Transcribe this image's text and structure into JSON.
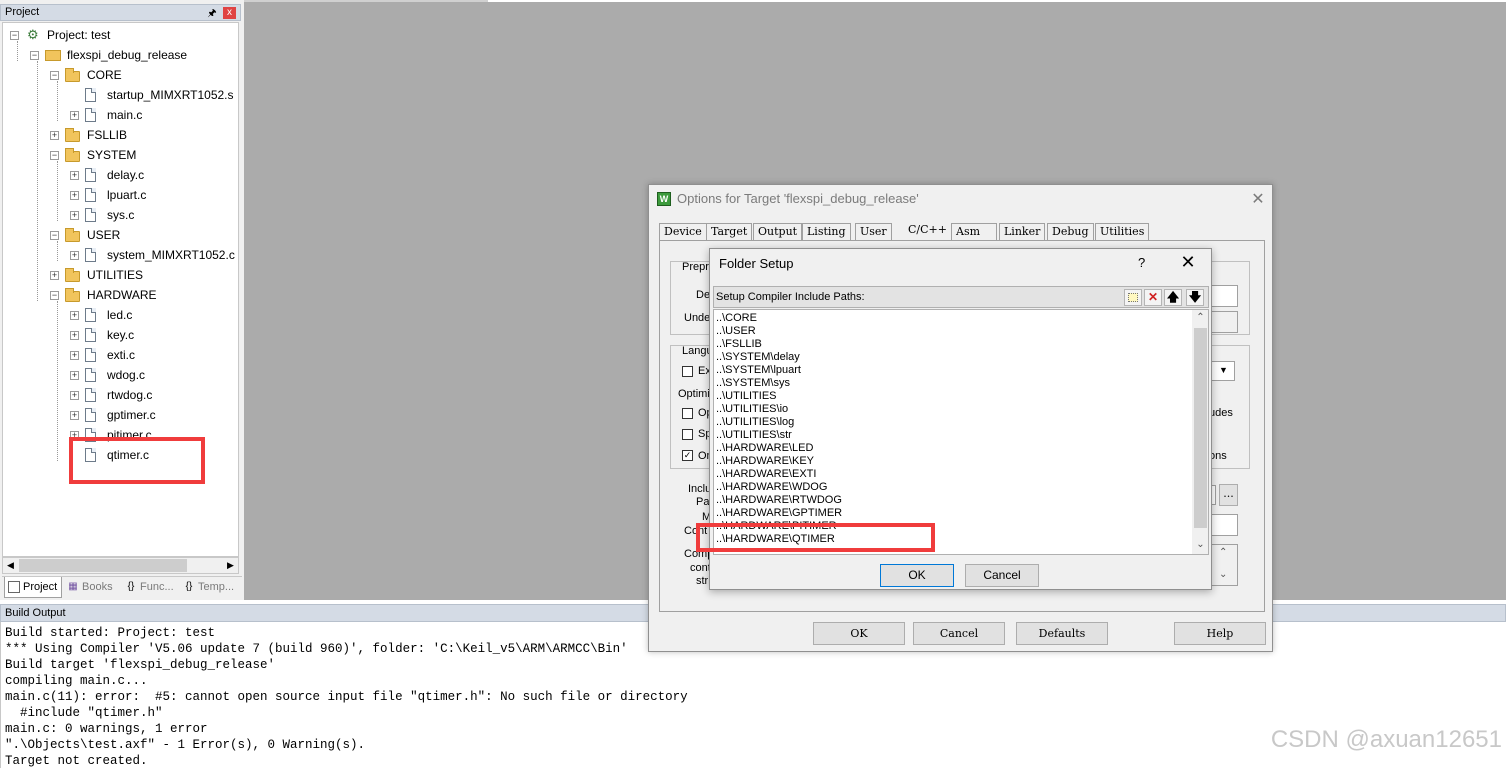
{
  "project_panel": {
    "title": "Project",
    "pin_icon": "pin-icon",
    "close_label": "x",
    "tree": {
      "root": "Project: test",
      "target": "flexspi_debug_release",
      "groups": [
        {
          "name": "CORE",
          "files": [
            "startup_MIMXRT1052.s",
            "main.c"
          ]
        },
        {
          "name": "FSLLIB",
          "files": []
        },
        {
          "name": "SYSTEM",
          "files": [
            "delay.c",
            "lpuart.c",
            "sys.c"
          ]
        },
        {
          "name": "USER",
          "files": [
            "system_MIMXRT1052.c"
          ]
        },
        {
          "name": "UTILITIES",
          "files": []
        },
        {
          "name": "HARDWARE",
          "files": [
            "led.c",
            "key.c",
            "exti.c",
            "wdog.c",
            "rtwdog.c",
            "gptimer.c",
            "pitimer.c",
            "qtimer.c"
          ]
        }
      ]
    },
    "tabs": [
      "Project",
      "Books",
      "Func...",
      "Temp..."
    ],
    "tab_icons": [
      "project-tab-icon",
      "books-icon",
      "{}",
      "{}"
    ]
  },
  "build_output": {
    "title": "Build Output",
    "lines": [
      "Build started: Project: test",
      "*** Using Compiler 'V5.06 update 7 (build 960)', folder: 'C:\\Keil_v5\\ARM\\ARMCC\\Bin'",
      "Build target 'flexspi_debug_release'",
      "compiling main.c...",
      "main.c(11): error:  #5: cannot open source input file \"qtimer.h\": No such file or directory",
      "  #include \"qtimer.h\"",
      "main.c: 0 warnings, 1 error",
      "\".\\Objects\\test.axf\" - 1 Error(s), 0 Warning(s).",
      "Target not created."
    ],
    "watermark": "CSDN @axuan12651"
  },
  "options_dialog": {
    "title": "Options for Target 'flexspi_debug_release'",
    "icon_letter": "W",
    "close_label": "✕",
    "tabs": [
      "Device",
      "Target",
      "Output",
      "Listing",
      "User",
      "C/C++",
      "Asm",
      "Linker",
      "Debug",
      "Utilities"
    ],
    "active_tab": "C/C++",
    "partial_labels": {
      "preprocessor": "Prepro",
      "define": "Def",
      "undefine": "Undef",
      "language": "Langu",
      "execute": "Ex",
      "optimization": "Optimiz",
      "opt1": "Op",
      "opt2": "Sp",
      "opt3": "On",
      "include": "Inclu",
      "paths": "Pat",
      "misc": "M",
      "controls": "Cont",
      "compiler": "Comp",
      "control": "cont",
      "string": "stri",
      "includes_tail": "udes",
      "options_tail": "ons"
    },
    "buttons": {
      "ok": "OK",
      "cancel": "Cancel",
      "defaults": "Defaults",
      "help": "Help",
      "browse": "..."
    }
  },
  "folder_setup": {
    "title": "Folder Setup",
    "help_label": "?",
    "close_label": "✕",
    "header": "Setup Compiler Include Paths:",
    "toolbar_icons": [
      "new-folder-icon",
      "delete-icon",
      "move-up-icon",
      "move-down-icon"
    ],
    "paths": [
      "..\\CORE",
      "..\\USER",
      "..\\FSLLIB",
      "..\\SYSTEM\\delay",
      "..\\SYSTEM\\lpuart",
      "..\\SYSTEM\\sys",
      "..\\UTILITIES",
      "..\\UTILITIES\\io",
      "..\\UTILITIES\\log",
      "..\\UTILITIES\\str",
      "..\\HARDWARE\\LED",
      "..\\HARDWARE\\KEY",
      "..\\HARDWARE\\EXTI",
      "..\\HARDWARE\\WDOG",
      "..\\HARDWARE\\RTWDOG",
      "..\\HARDWARE\\GPTIMER",
      "..\\HARDWARE\\PITIMER",
      "..\\HARDWARE\\QTIMER"
    ],
    "buttons": {
      "ok": "OK",
      "cancel": "Cancel"
    }
  },
  "colors": {
    "highlight": "#f03c3c",
    "workspace": "#ababab",
    "titlebar": "#d4dbe5"
  }
}
